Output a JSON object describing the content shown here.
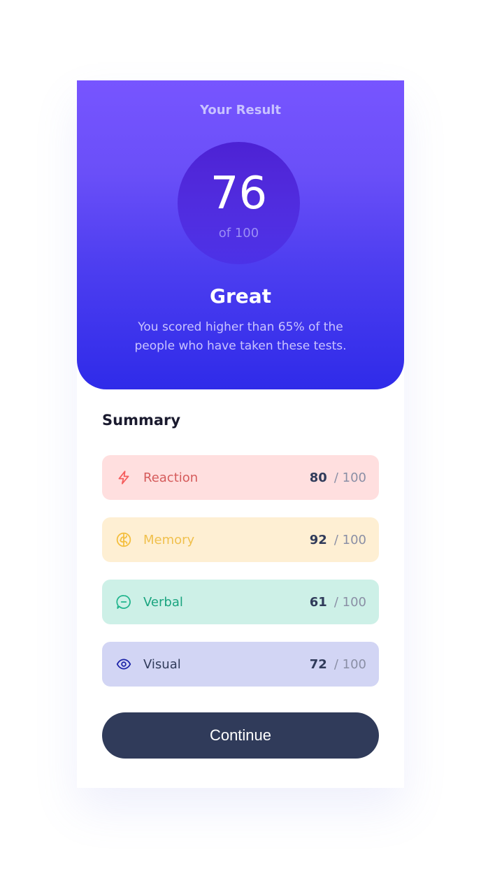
{
  "result": {
    "heading": "Your Result",
    "score": "76",
    "total": "of 100",
    "verdict": "Great",
    "description": "You scored higher than 65% of the people who have taken these tests."
  },
  "summary": {
    "title": "Summary",
    "items": [
      {
        "label": "Reaction",
        "score": "80",
        "max": "/ 100",
        "icon": "lightning-icon",
        "color": "#f55d5d",
        "bg": "#ffdfdf"
      },
      {
        "label": "Memory",
        "score": "92",
        "max": "/ 100",
        "icon": "brain-icon",
        "color": "#f4be3c",
        "bg": "#feefd3"
      },
      {
        "label": "Verbal",
        "score": "61",
        "max": "/ 100",
        "icon": "chat-bubble-icon",
        "color": "#1fb48c",
        "bg": "#cdf0e7"
      },
      {
        "label": "Visual",
        "score": "72",
        "max": "/ 100",
        "icon": "eye-icon",
        "color": "#1b23a8",
        "bg": "#d2d5f4"
      }
    ]
  },
  "actions": {
    "continue_label": "Continue"
  },
  "colors": {
    "gradient_top": "#7755ff",
    "gradient_bottom": "#2f2be9",
    "button": "#303b5a"
  }
}
